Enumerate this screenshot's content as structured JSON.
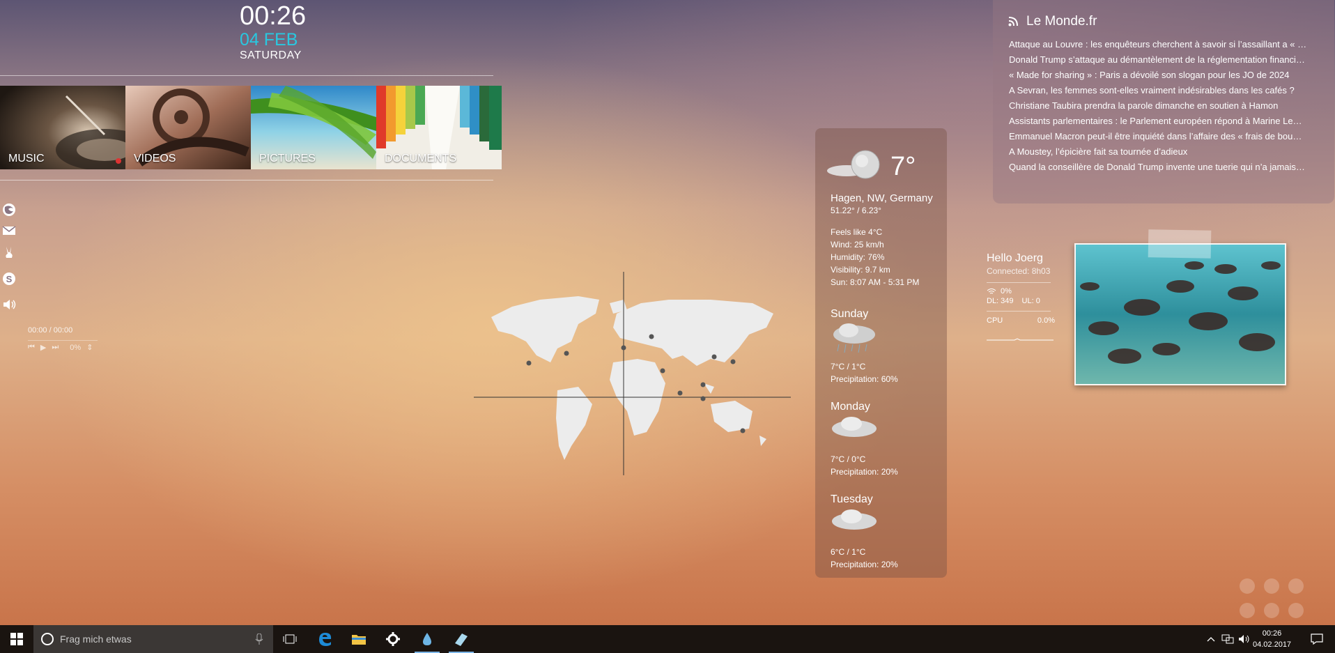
{
  "clock": {
    "time": "00:26",
    "date": "04 FEB",
    "day": "SATURDAY"
  },
  "tiles": [
    {
      "label": "MUSIC"
    },
    {
      "label": "VIDEOS"
    },
    {
      "label": "PICTURES"
    },
    {
      "label": "DOCUMENTS"
    }
  ],
  "dock_icons": [
    "firefox-icon",
    "mail-icon",
    "rabbit-icon",
    "skype-icon",
    "volume-icon"
  ],
  "player": {
    "time": "00:00 / 00:00",
    "volume": "0%"
  },
  "weather": {
    "current_temp": "7°",
    "location": "Hagen, NW, Germany",
    "coords": "51.22° / 6.23°",
    "feels_like": "Feels like 4°C",
    "wind": "Wind: 25 km/h",
    "humidity": "Humidity: 76%",
    "visibility": "Visibility: 9.7 km",
    "sun": "Sun: 8:07 AM - 5:31 PM",
    "forecast": [
      {
        "day": "Sunday",
        "temps": "7°C / 1°C",
        "precip": "Precipitation: 60%",
        "icon": "rain-cloud-icon"
      },
      {
        "day": "Monday",
        "temps": "7°C / 0°C",
        "precip": "Precipitation: 20%",
        "icon": "cloud-icon"
      },
      {
        "day": "Tuesday",
        "temps": "6°C / 1°C",
        "precip": "Precipitation: 20%",
        "icon": "cloud-icon"
      }
    ]
  },
  "news": {
    "title": "Le Monde.fr",
    "items": [
      "Attaque au Louvre : les enquêteurs cherchent à savoir si l’assaillant a « …",
      "Donald Trump s’attaque au démantèlement de la réglementation financi…",
      "« Made for sharing » : Paris a dévoilé son slogan pour les JO de 2024",
      "A Sevran, les femmes sont-elles vraiment indésirables dans les cafés ?",
      "Christiane Taubira prendra la parole dimanche en soutien à Hamon",
      "Assistants parlementaires : le Parlement européen répond à Marine Le…",
      "Emmanuel Macron peut-il être inquiété dans l’affaire des « frais de bou…",
      "A Moustey, l’épicière fait sa tournée d’adieux",
      "Quand la conseillère de Donald Trump invente une tuerie qui n’a jamais…"
    ]
  },
  "sysinfo": {
    "hello": "Hello Joerg",
    "connected": "Connected: 8h03",
    "wifi": "0%",
    "dl": "DL: 349",
    "ul": "UL: 0",
    "cpu_label": "CPU",
    "cpu_value": "0.0%"
  },
  "taskbar": {
    "search_placeholder": "Frag mich etwas",
    "time": "00:26",
    "date": "04.02.2017"
  },
  "colors": {
    "accent": "#29c8e0"
  }
}
